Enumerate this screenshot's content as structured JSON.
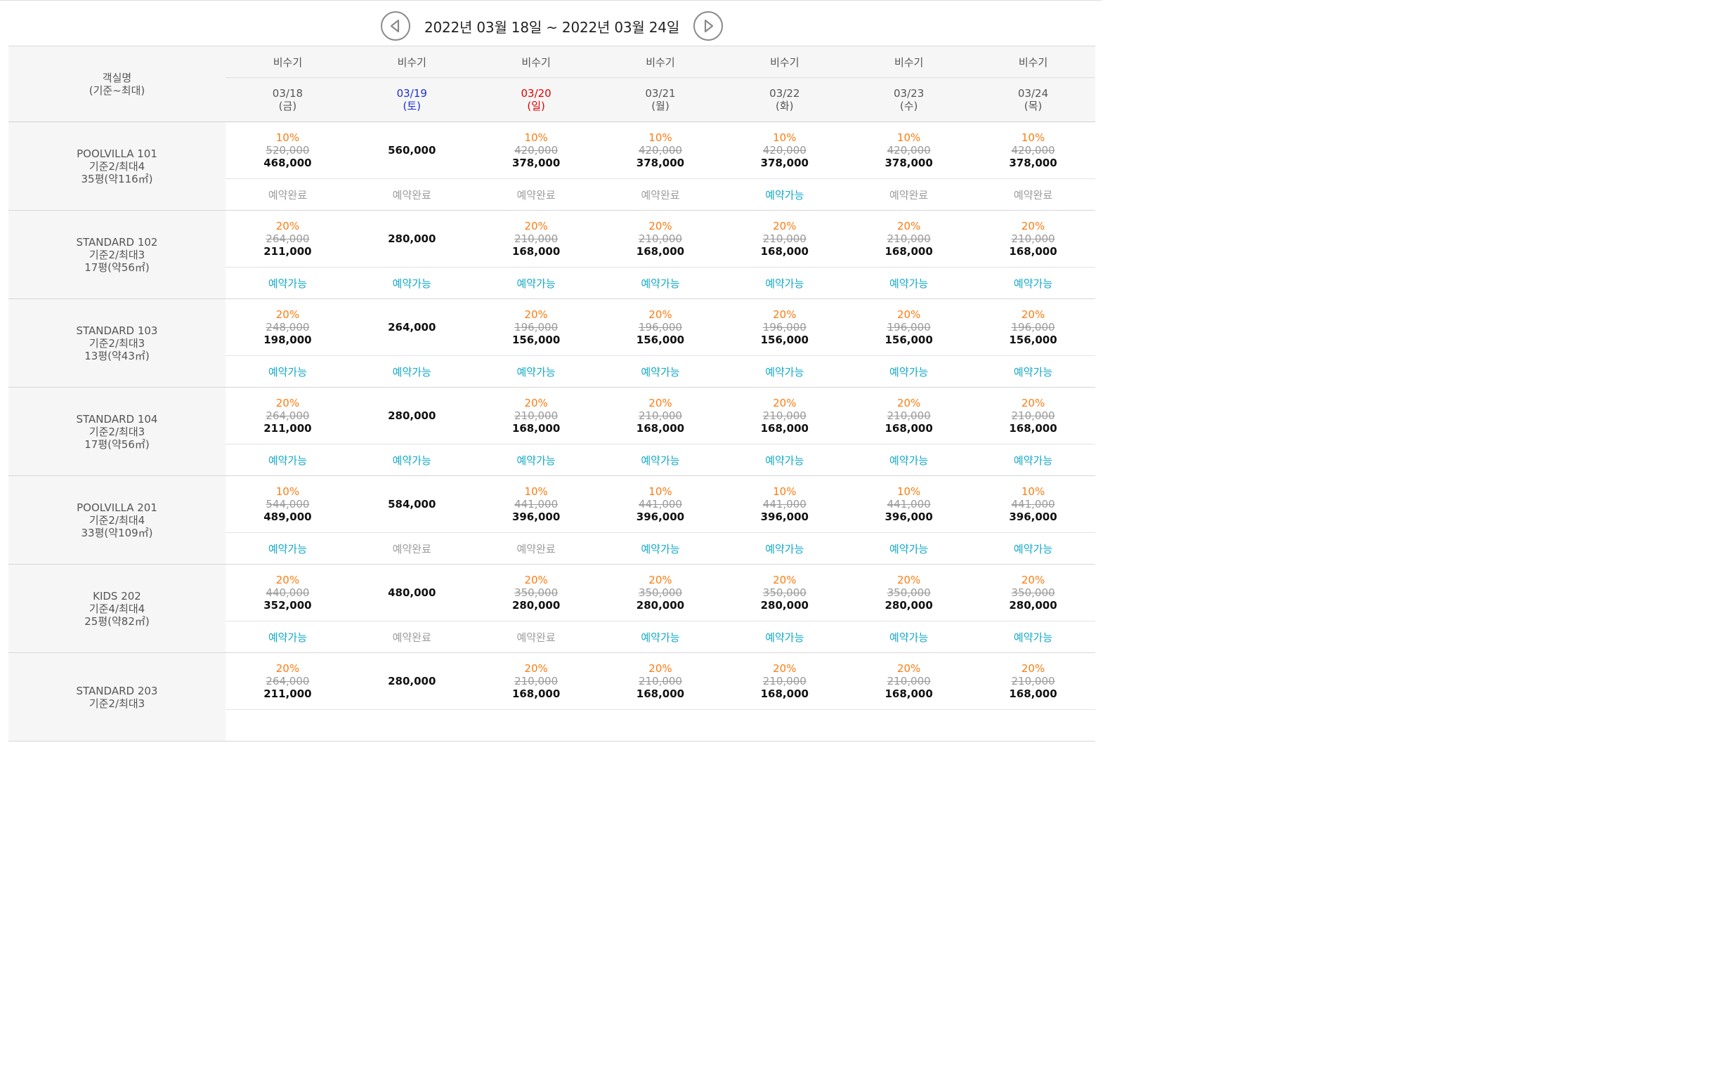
{
  "nav": {
    "title": "2022년 03월 18일 ~ 2022년 03월 24일",
    "prev_icon": "chevron-left-circle-icon",
    "next_icon": "chevron-right-circle-icon"
  },
  "header": {
    "room_label": "객실명",
    "room_sublabel": "(기준~최대)",
    "days": [
      {
        "season": "비수기",
        "date": "03/18",
        "dow": "(금)",
        "type": "weekday"
      },
      {
        "season": "비수기",
        "date": "03/19",
        "dow": "(토)",
        "type": "sat"
      },
      {
        "season": "비수기",
        "date": "03/20",
        "dow": "(일)",
        "type": "sun"
      },
      {
        "season": "비수기",
        "date": "03/21",
        "dow": "(월)",
        "type": "weekday"
      },
      {
        "season": "비수기",
        "date": "03/22",
        "dow": "(화)",
        "type": "weekday"
      },
      {
        "season": "비수기",
        "date": "03/23",
        "dow": "(수)",
        "type": "weekday"
      },
      {
        "season": "비수기",
        "date": "03/24",
        "dow": "(목)",
        "type": "weekday"
      }
    ]
  },
  "colors": {
    "discount": "#ff7b10",
    "available": "#12a9c6",
    "booked": "#9c9c9c",
    "saturday": "#1a2fd6",
    "sunday": "#e00000"
  },
  "rooms": [
    {
      "name": "POOLVILLA 101",
      "capacity": "기준2/최대4",
      "size": "35평(약116㎡)",
      "days": [
        {
          "pct": "10%",
          "orig": "520,000",
          "price": "468,000",
          "status": "예약완료",
          "avail": false
        },
        {
          "pct": "",
          "orig": "",
          "price": "560,000",
          "status": "예약완료",
          "avail": false
        },
        {
          "pct": "10%",
          "orig": "420,000",
          "price": "378,000",
          "status": "예약완료",
          "avail": false
        },
        {
          "pct": "10%",
          "orig": "420,000",
          "price": "378,000",
          "status": "예약완료",
          "avail": false
        },
        {
          "pct": "10%",
          "orig": "420,000",
          "price": "378,000",
          "status": "예약가능",
          "avail": true
        },
        {
          "pct": "10%",
          "orig": "420,000",
          "price": "378,000",
          "status": "예약완료",
          "avail": false
        },
        {
          "pct": "10%",
          "orig": "420,000",
          "price": "378,000",
          "status": "예약완료",
          "avail": false
        }
      ]
    },
    {
      "name": "STANDARD 102",
      "capacity": "기준2/최대3",
      "size": "17평(약56㎡)",
      "days": [
        {
          "pct": "20%",
          "orig": "264,000",
          "price": "211,000",
          "status": "예약가능",
          "avail": true
        },
        {
          "pct": "",
          "orig": "",
          "price": "280,000",
          "status": "예약가능",
          "avail": true
        },
        {
          "pct": "20%",
          "orig": "210,000",
          "price": "168,000",
          "status": "예약가능",
          "avail": true
        },
        {
          "pct": "20%",
          "orig": "210,000",
          "price": "168,000",
          "status": "예약가능",
          "avail": true
        },
        {
          "pct": "20%",
          "orig": "210,000",
          "price": "168,000",
          "status": "예약가능",
          "avail": true
        },
        {
          "pct": "20%",
          "orig": "210,000",
          "price": "168,000",
          "status": "예약가능",
          "avail": true
        },
        {
          "pct": "20%",
          "orig": "210,000",
          "price": "168,000",
          "status": "예약가능",
          "avail": true
        }
      ]
    },
    {
      "name": "STANDARD 103",
      "capacity": "기준2/최대3",
      "size": "13평(약43㎡)",
      "days": [
        {
          "pct": "20%",
          "orig": "248,000",
          "price": "198,000",
          "status": "예약가능",
          "avail": true
        },
        {
          "pct": "",
          "orig": "",
          "price": "264,000",
          "status": "예약가능",
          "avail": true
        },
        {
          "pct": "20%",
          "orig": "196,000",
          "price": "156,000",
          "status": "예약가능",
          "avail": true
        },
        {
          "pct": "20%",
          "orig": "196,000",
          "price": "156,000",
          "status": "예약가능",
          "avail": true
        },
        {
          "pct": "20%",
          "orig": "196,000",
          "price": "156,000",
          "status": "예약가능",
          "avail": true
        },
        {
          "pct": "20%",
          "orig": "196,000",
          "price": "156,000",
          "status": "예약가능",
          "avail": true
        },
        {
          "pct": "20%",
          "orig": "196,000",
          "price": "156,000",
          "status": "예약가능",
          "avail": true
        }
      ]
    },
    {
      "name": "STANDARD 104",
      "capacity": "기준2/최대3",
      "size": "17평(약56㎡)",
      "days": [
        {
          "pct": "20%",
          "orig": "264,000",
          "price": "211,000",
          "status": "예약가능",
          "avail": true
        },
        {
          "pct": "",
          "orig": "",
          "price": "280,000",
          "status": "예약가능",
          "avail": true
        },
        {
          "pct": "20%",
          "orig": "210,000",
          "price": "168,000",
          "status": "예약가능",
          "avail": true
        },
        {
          "pct": "20%",
          "orig": "210,000",
          "price": "168,000",
          "status": "예약가능",
          "avail": true
        },
        {
          "pct": "20%",
          "orig": "210,000",
          "price": "168,000",
          "status": "예약가능",
          "avail": true
        },
        {
          "pct": "20%",
          "orig": "210,000",
          "price": "168,000",
          "status": "예약가능",
          "avail": true
        },
        {
          "pct": "20%",
          "orig": "210,000",
          "price": "168,000",
          "status": "예약가능",
          "avail": true
        }
      ]
    },
    {
      "name": "POOLVILLA 201",
      "capacity": "기준2/최대4",
      "size": "33평(약109㎡)",
      "days": [
        {
          "pct": "10%",
          "orig": "544,000",
          "price": "489,000",
          "status": "예약가능",
          "avail": true
        },
        {
          "pct": "",
          "orig": "",
          "price": "584,000",
          "status": "예약완료",
          "avail": false
        },
        {
          "pct": "10%",
          "orig": "441,000",
          "price": "396,000",
          "status": "예약완료",
          "avail": false
        },
        {
          "pct": "10%",
          "orig": "441,000",
          "price": "396,000",
          "status": "예약가능",
          "avail": true
        },
        {
          "pct": "10%",
          "orig": "441,000",
          "price": "396,000",
          "status": "예약가능",
          "avail": true
        },
        {
          "pct": "10%",
          "orig": "441,000",
          "price": "396,000",
          "status": "예약가능",
          "avail": true
        },
        {
          "pct": "10%",
          "orig": "441,000",
          "price": "396,000",
          "status": "예약가능",
          "avail": true
        }
      ]
    },
    {
      "name": "KIDS 202",
      "capacity": "기준4/최대4",
      "size": "25평(약82㎡)",
      "days": [
        {
          "pct": "20%",
          "orig": "440,000",
          "price": "352,000",
          "status": "예약가능",
          "avail": true
        },
        {
          "pct": "",
          "orig": "",
          "price": "480,000",
          "status": "예약완료",
          "avail": false
        },
        {
          "pct": "20%",
          "orig": "350,000",
          "price": "280,000",
          "status": "예약완료",
          "avail": false
        },
        {
          "pct": "20%",
          "orig": "350,000",
          "price": "280,000",
          "status": "예약가능",
          "avail": true
        },
        {
          "pct": "20%",
          "orig": "350,000",
          "price": "280,000",
          "status": "예약가능",
          "avail": true
        },
        {
          "pct": "20%",
          "orig": "350,000",
          "price": "280,000",
          "status": "예약가능",
          "avail": true
        },
        {
          "pct": "20%",
          "orig": "350,000",
          "price": "280,000",
          "status": "예약가능",
          "avail": true
        }
      ]
    },
    {
      "name": "STANDARD 203",
      "capacity": "기준2/최대3",
      "size": "",
      "days": [
        {
          "pct": "20%",
          "orig": "264,000",
          "price": "211,000",
          "status": "",
          "avail": true
        },
        {
          "pct": "",
          "orig": "",
          "price": "280,000",
          "status": "",
          "avail": true
        },
        {
          "pct": "20%",
          "orig": "210,000",
          "price": "168,000",
          "status": "",
          "avail": true
        },
        {
          "pct": "20%",
          "orig": "210,000",
          "price": "168,000",
          "status": "",
          "avail": true
        },
        {
          "pct": "20%",
          "orig": "210,000",
          "price": "168,000",
          "status": "",
          "avail": true
        },
        {
          "pct": "20%",
          "orig": "210,000",
          "price": "168,000",
          "status": "",
          "avail": true
        },
        {
          "pct": "20%",
          "orig": "210,000",
          "price": "168,000",
          "status": "",
          "avail": true
        }
      ]
    }
  ]
}
